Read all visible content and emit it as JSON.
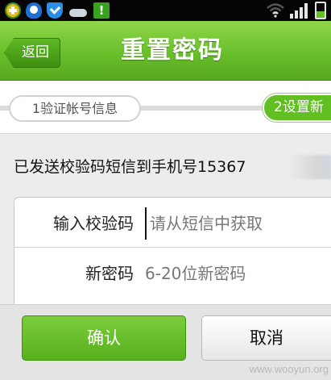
{
  "status_bar": {
    "icons": [
      "add-icon",
      "qq-icon",
      "shield-icon",
      "weather-icon",
      "alert-icon",
      "wifi-icon",
      "signal-icon",
      "battery-icon"
    ],
    "alert_glyph": "!",
    "background": "#050505"
  },
  "header": {
    "back_label": "返回",
    "title": "重置密码",
    "accent": "#6cc12e"
  },
  "steps": {
    "step1_label": "1验证帐号信息",
    "step2_label": "2设置新",
    "active_step": 2
  },
  "notice": {
    "text": "已发送校验码短信到手机号15367"
  },
  "form": {
    "code_label": "输入校验码",
    "code_placeholder": "请从短信中获取",
    "password_label": "新密码",
    "password_placeholder": "6-20位新密码"
  },
  "footer": {
    "confirm_label": "确认",
    "cancel_label": "取消"
  },
  "watermark": "www.wooyun.org"
}
